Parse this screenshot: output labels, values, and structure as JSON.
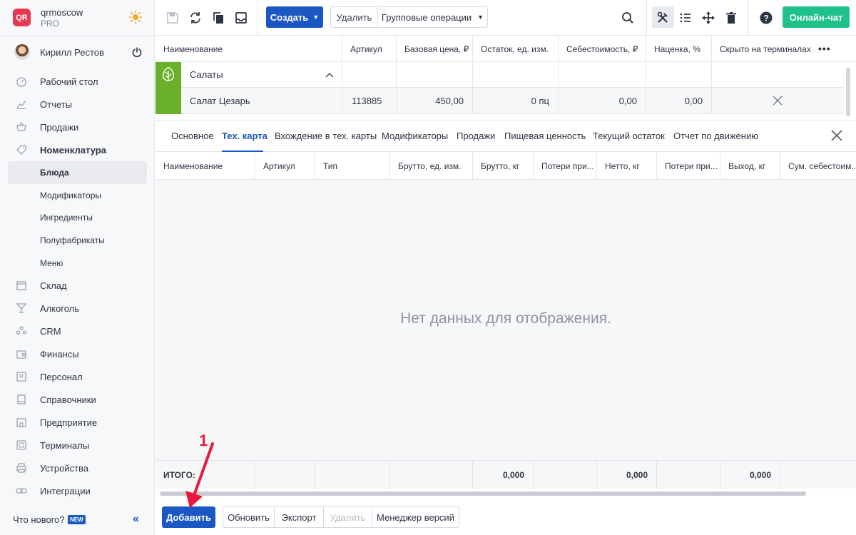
{
  "brand": {
    "name": "qrmoscow",
    "plan": "PRO",
    "logo_text": "QR"
  },
  "user": {
    "name": "Кирилл Рестов"
  },
  "nav": {
    "items": [
      {
        "label": "Рабочий стол",
        "icon": "gauge-icon"
      },
      {
        "label": "Отчеты",
        "icon": "chart-icon"
      },
      {
        "label": "Продажи",
        "icon": "basket-icon"
      },
      {
        "label": "Номенклатура",
        "icon": "tag-icon"
      }
    ],
    "sub_items": [
      "Блюда",
      "Модификаторы",
      "Ингредиенты",
      "Полуфабрикаты",
      "Меню"
    ],
    "items2": [
      {
        "label": "Склад",
        "icon": "box-icon"
      },
      {
        "label": "Алкоголь",
        "icon": "glass-icon"
      },
      {
        "label": "CRM",
        "icon": "people-icon"
      },
      {
        "label": "Финансы",
        "icon": "wallet-icon"
      },
      {
        "label": "Персонал",
        "icon": "person-icon"
      },
      {
        "label": "Справочники",
        "icon": "book-icon"
      },
      {
        "label": "Предприятие",
        "icon": "building-icon"
      },
      {
        "label": "Терминалы",
        "icon": "qr-icon"
      },
      {
        "label": "Устройства",
        "icon": "printer-icon"
      },
      {
        "label": "Интеграции",
        "icon": "link-icon"
      }
    ]
  },
  "whatsnew": {
    "label": "Что нового?",
    "badge": "NEW"
  },
  "toolbar": {
    "create": "Создать",
    "delete": "Удалить",
    "group_ops": "Групповые операции",
    "chat": "Онлайн-чат"
  },
  "grid": {
    "columns": [
      "Наименование",
      "Артикул",
      "Базовая цена, ₽",
      "Остаток, ед. изм.",
      "Себестоимость, ₽",
      "Наценка, %",
      "Скрыто на терминалах"
    ],
    "group": "Салаты",
    "row": {
      "name": "Салат Цезарь",
      "article": "113885",
      "price": "450,00",
      "stock": "0 пц",
      "cost": "0,00",
      "markup": "0,00"
    }
  },
  "tabs": [
    "Основное",
    "Тех. карта",
    "Вхождение в тех. карты",
    "Модификаторы",
    "Продажи",
    "Пищевая ценность",
    "Текущий остаток",
    "Отчет по движению"
  ],
  "subgrid": {
    "columns": [
      "Наименование",
      "Артикул",
      "Тип",
      "Брутто, ед. изм.",
      "Брутто, кг",
      "Потери при...",
      "Нетто, кг",
      "Потери при...",
      "Выход, кг",
      "Сум. себестоим..."
    ],
    "empty": "Нет данных для отображения.",
    "totals_label": "ИТОГО:",
    "totals": [
      "0,000",
      "0,000",
      "0,000"
    ]
  },
  "bottom": {
    "add": "Добавить",
    "refresh": "Обновить",
    "export": "Экспорт",
    "delete": "Удалить",
    "versions": "Менеджер версий"
  },
  "annotation": {
    "number": "1"
  },
  "colors": {
    "accent": "#1b57c2",
    "green": "#1fc18a",
    "category": "#6ab02b",
    "annotation": "#e8193c"
  }
}
